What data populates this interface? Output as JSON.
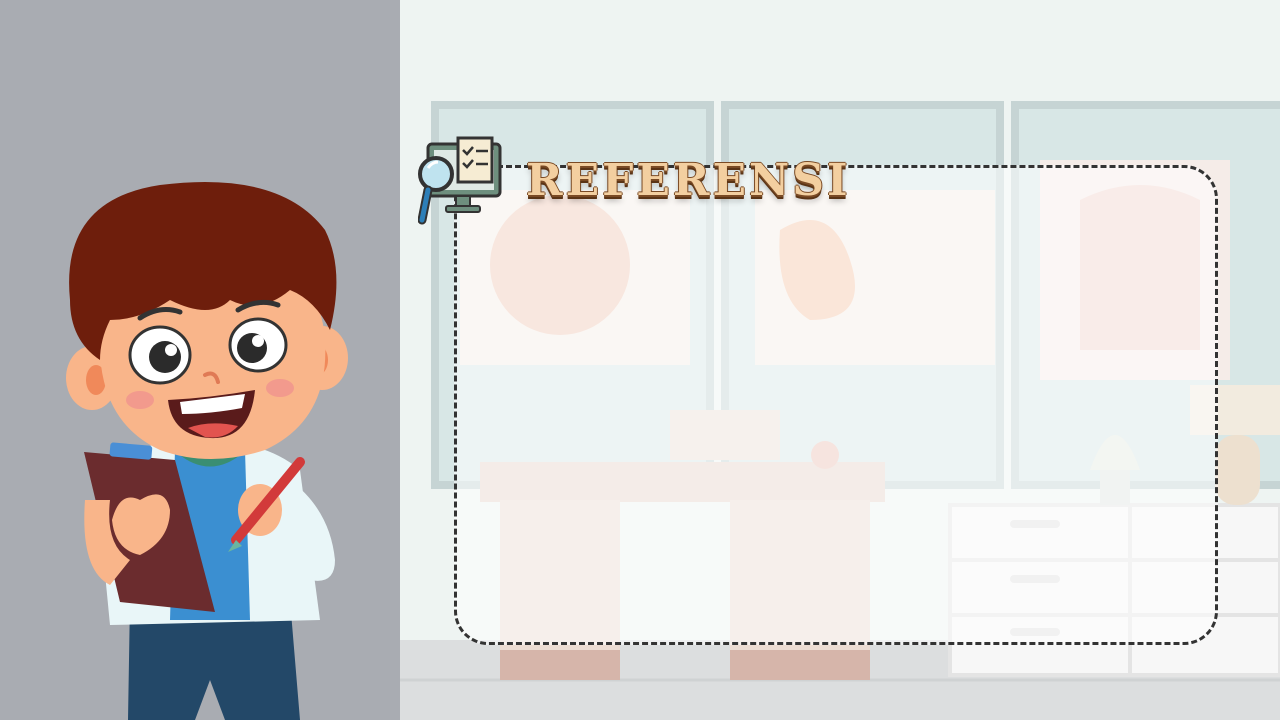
{
  "slide": {
    "title": "REFERENSI",
    "accent_color": "#f3cfa0",
    "panel_color": "#a9acb2"
  },
  "icons": {
    "title_icon": "magnifier-checklist-monitor-icon",
    "character": "boy-with-clipboard-illustration"
  }
}
